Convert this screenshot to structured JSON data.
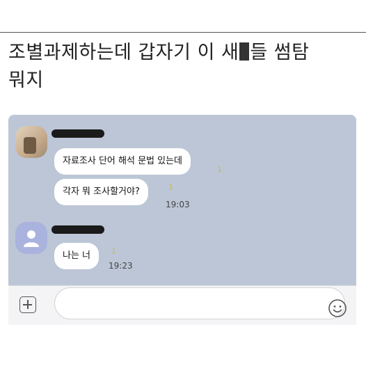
{
  "caption": {
    "line1_before": "조별과제하는데 갑자기 이 새",
    "line1_after": "들 썸탐",
    "line2": "뭐지"
  },
  "messages": [
    {
      "text": "자료조사 단어 해석 문법 있는데"
    },
    {
      "text": "각자 뭐 조사할거야?",
      "time": "19:03"
    },
    {
      "text": "나는 너",
      "time": "19:23"
    }
  ],
  "read_mark": "1",
  "input_bar": {
    "placeholder": "",
    "hash_symbol": "#"
  },
  "icons": [
    "plus-icon",
    "emoji-icon",
    "hash-icon",
    "default-avatar-icon"
  ],
  "colors": {
    "chat_background": "#bcc6d6",
    "bubble": "#ffffff",
    "read_mark": "#c9b85a"
  }
}
